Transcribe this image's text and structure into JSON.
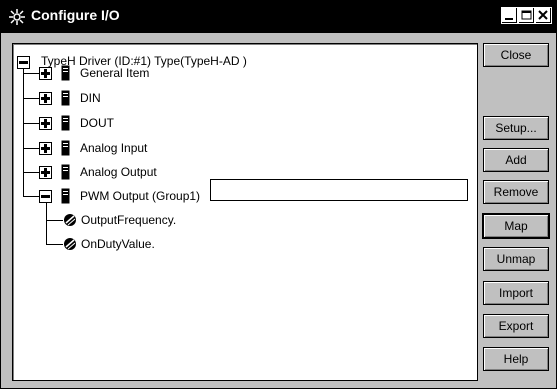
{
  "window": {
    "title": "Configure I/O"
  },
  "tree": {
    "root": {
      "label": "TypeH Driver (ID:#1) Type(TypeH-AD )"
    },
    "items": [
      {
        "label": "General Item",
        "expander": "plus"
      },
      {
        "label": "DIN",
        "expander": "plus"
      },
      {
        "label": "DOUT",
        "expander": "plus"
      },
      {
        "label": "Analog Input",
        "expander": "plus"
      },
      {
        "label": "Analog Output",
        "expander": "plus"
      },
      {
        "label": "PWM Output (Group1)",
        "expander": "minus"
      }
    ],
    "children": [
      {
        "label": "OutputFrequency."
      },
      {
        "label": "OnDutyValue."
      }
    ],
    "edit_value": ""
  },
  "buttons": {
    "close": "Close",
    "setup": "Setup...",
    "add": "Add",
    "remove": "Remove",
    "map": "Map",
    "unmap": "Unmap",
    "import": "Import",
    "export": "Export",
    "help": "Help"
  },
  "icons": {
    "title": "gear-icon",
    "item": "document-icon",
    "variable": "tag-icon"
  }
}
